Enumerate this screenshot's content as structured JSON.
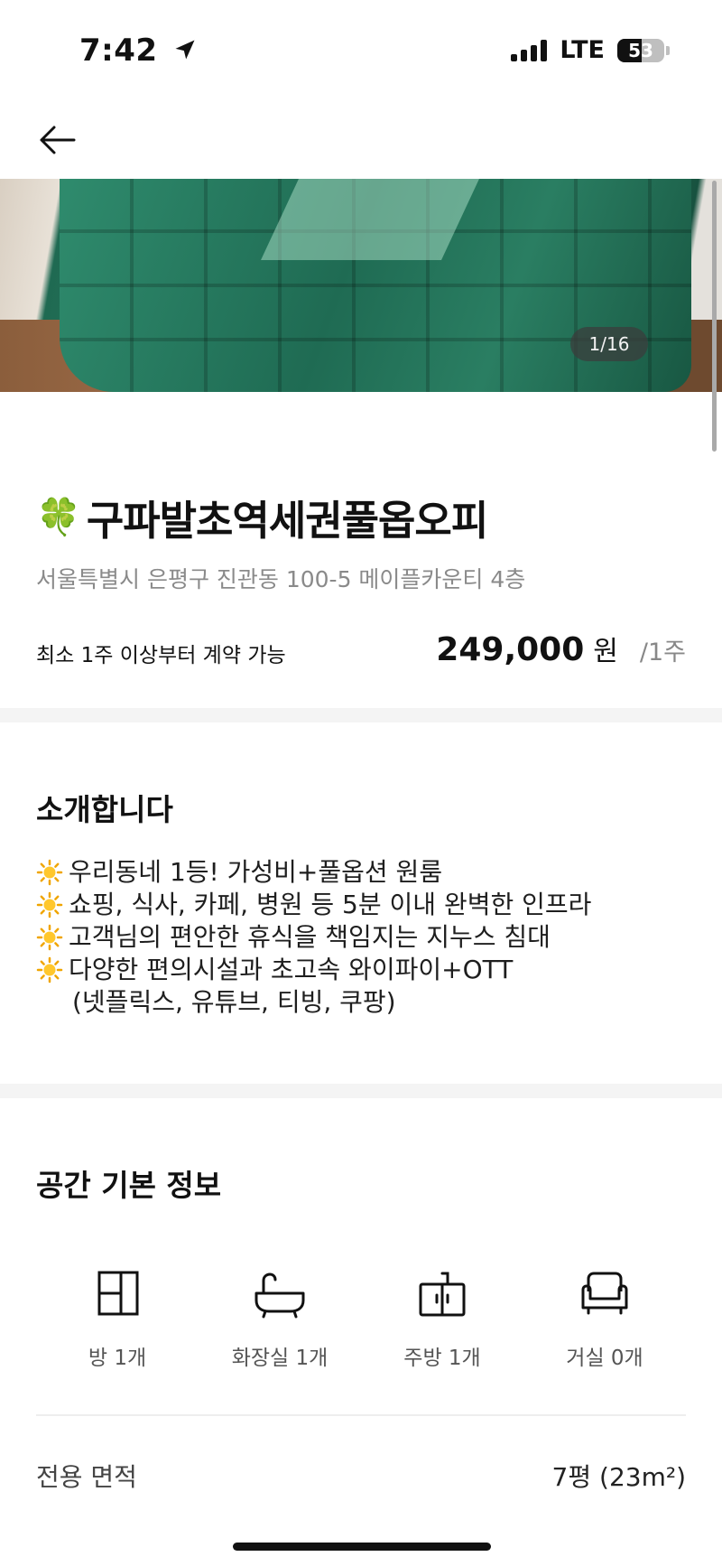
{
  "status_bar": {
    "time": "7:42",
    "network": "LTE",
    "battery": "53"
  },
  "gallery": {
    "counter": "1/16"
  },
  "listing": {
    "title_emoji": "🍀",
    "title": "구파발초역세권풀옵오피",
    "address": "서울특별시 은평구 진관동 100-5 메이플카운티 4층",
    "contract_note": "최소 1주 이상부터 계약 가능",
    "price": "249,000",
    "price_unit": "원",
    "price_period": "/1주"
  },
  "intro": {
    "heading": "소개합니다",
    "lines": [
      "우리동네 1등! 가성비+풀옵션 원룸",
      "쇼핑, 식사, 카페, 병원 등 5분 이내 완벽한 인프라",
      "고객님의 편안한 휴식을 책임지는 지누스 침대",
      "다양한 편의시설과 초고속 와이파이+OTT"
    ],
    "line_continuation": "(넷플릭스, 유튜브, 티빙, 쿠팡)"
  },
  "space_info": {
    "heading": "공간 기본 정보",
    "rooms": [
      {
        "icon": "room-icon",
        "label": "방 1개"
      },
      {
        "icon": "bathtub-icon",
        "label": "화장실 1개"
      },
      {
        "icon": "kitchen-icon",
        "label": "주방 1개"
      },
      {
        "icon": "sofa-icon",
        "label": "거실 0개"
      }
    ],
    "area_label": "전용 면적",
    "area_value": "7평 (23m²)"
  }
}
